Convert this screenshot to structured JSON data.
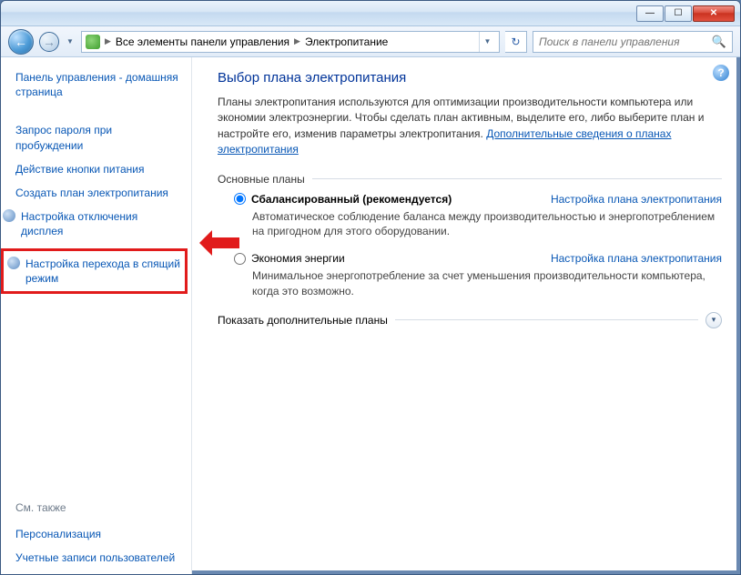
{
  "titlebar": {
    "min": "—",
    "max": "☐",
    "close": "✕"
  },
  "breadcrumb": {
    "item1": "Все элементы панели управления",
    "item2": "Электропитание"
  },
  "search": {
    "placeholder": "Поиск в панели управления"
  },
  "sidebar": {
    "home": "Панель управления - домашняя страница",
    "items": [
      "Запрос пароля при пробуждении",
      "Действие кнопки питания",
      "Создать план электропитания",
      "Настройка отключения дисплея",
      "Настройка перехода в спящий режим"
    ],
    "seeAlsoLabel": "См. также",
    "seeAlso": [
      "Персонализация",
      "Учетные записи пользователей"
    ]
  },
  "main": {
    "heading": "Выбор плана электропитания",
    "intro1": "Планы электропитания используются для оптимизации производительности компьютера или экономии электроэнергии. Чтобы сделать план активным, выделите его, либо выберите план и настройте его, изменив параметры электропитания. ",
    "introLink": "Дополнительные сведения о планах электропитания",
    "sectionBasic": "Основные планы",
    "plans": [
      {
        "title": "Сбалансированный (рекомендуется)",
        "link": "Настройка плана электропитания",
        "desc": "Автоматическое соблюдение баланса между производительностью и энергопотреблением на пригодном для этого оборудовании."
      },
      {
        "title": "Экономия энергии",
        "link": "Настройка плана электропитания",
        "desc": "Минимальное энергопотребление за счет уменьшения производительности компьютера, когда это возможно."
      }
    ],
    "showMore": "Показать дополнительные планы"
  }
}
